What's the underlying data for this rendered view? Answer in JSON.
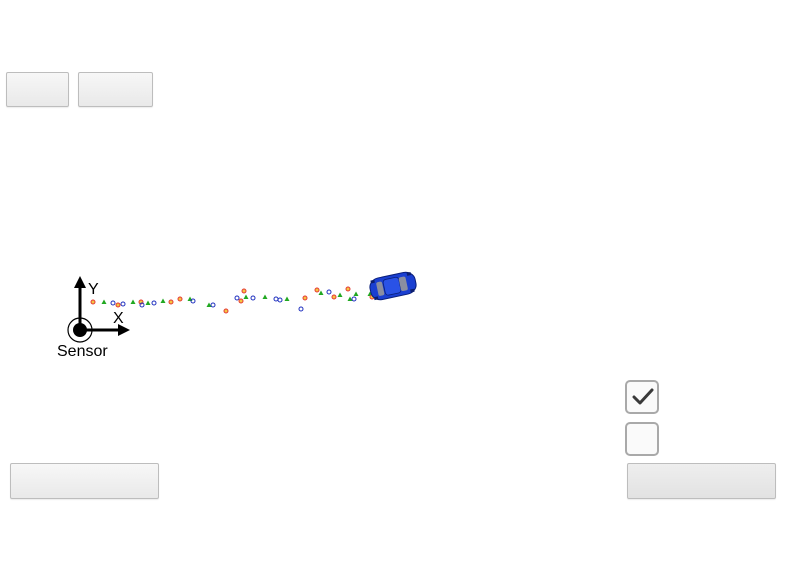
{
  "toolbar": {
    "button_1_label": "",
    "button_2_label": ""
  },
  "scene": {
    "sensor_label": "Sensor",
    "axis_y_label": "Y",
    "axis_x_label": "X",
    "car_color": "#1a3fd1",
    "detection_colors": [
      "#e53935",
      "#21a821",
      "#1e2fbf"
    ]
  },
  "controls": {
    "checkbox_1_checked": true,
    "checkbox_2_checked": false,
    "bottom_left_button_label": "",
    "bottom_right_button_label": ""
  }
}
